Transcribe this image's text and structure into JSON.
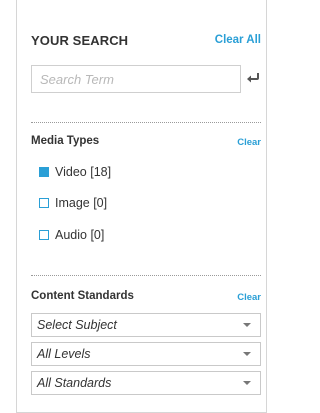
{
  "search": {
    "title": "YOUR SEARCH",
    "clear_all_label": "Clear All",
    "placeholder": "Search Term",
    "value": ""
  },
  "media_types": {
    "title": "Media Types",
    "clear_label": "Clear",
    "items": [
      {
        "label": "Video [18]",
        "checked": true
      },
      {
        "label": "Image [0]",
        "checked": false
      },
      {
        "label": "Audio [0]",
        "checked": false
      }
    ]
  },
  "content_standards": {
    "title": "Content Standards",
    "clear_label": "Clear",
    "selects": [
      {
        "value": "Select Subject"
      },
      {
        "value": "All Levels"
      },
      {
        "value": "All Standards"
      }
    ]
  },
  "colors": {
    "accent": "#2a9fd6",
    "border": "#d6d6d6"
  },
  "icons": {
    "submit": "return-arrow-icon",
    "dropdown": "caret-down-icon"
  }
}
